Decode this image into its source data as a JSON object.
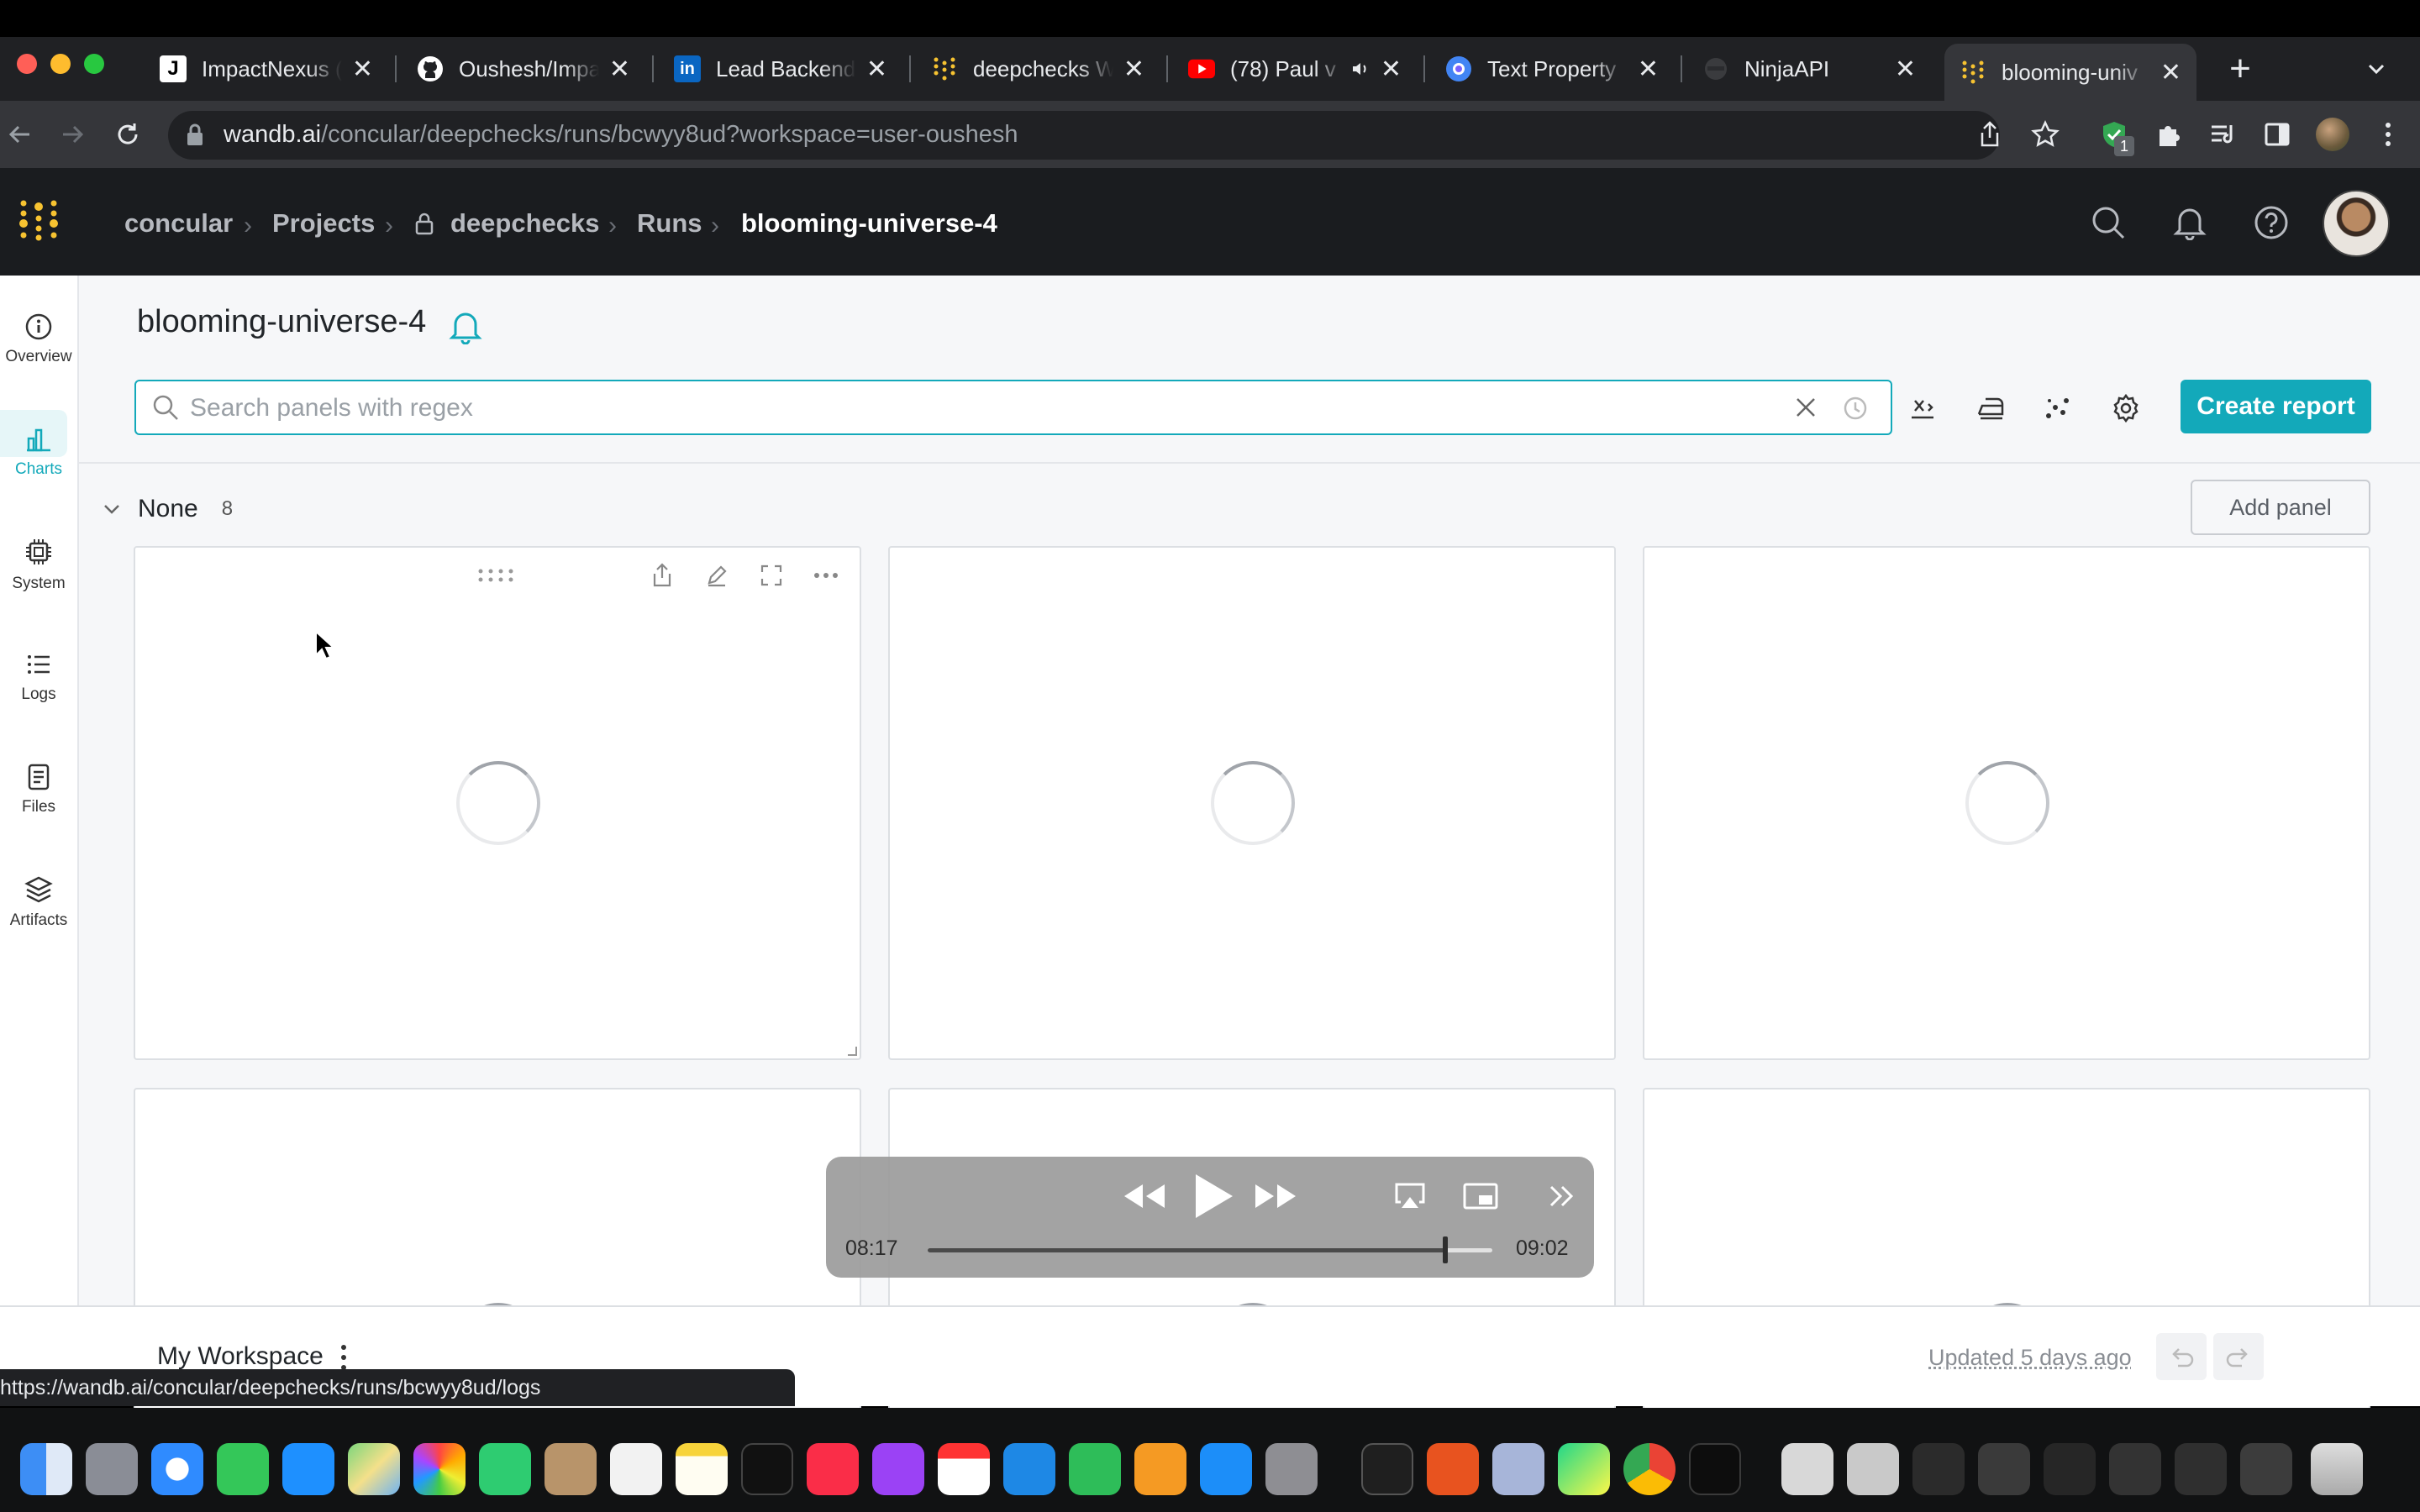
{
  "browser": {
    "tabs": [
      {
        "title": "ImpactNexus (",
        "icon": "jira-icon"
      },
      {
        "title": "Oushesh/Impa",
        "icon": "github-icon"
      },
      {
        "title": "Lead Backend",
        "icon": "linkedin-icon"
      },
      {
        "title": "deepchecks W",
        "icon": "wandb-icon"
      },
      {
        "title": "(78) Paul v",
        "icon": "youtube-icon"
      },
      {
        "title": "Text Property",
        "icon": "app-icon"
      },
      {
        "title": "NinjaAPI",
        "icon": "ninja-icon"
      },
      {
        "title": "blooming-univ",
        "icon": "wandb-icon"
      }
    ],
    "url_host": "wandb.ai",
    "url_path": "/concular/deepchecks/runs/bcwyy8ud?workspace=user-oushesh",
    "extension_badge": "1",
    "status_url": "https://wandb.ai/concular/deepchecks/runs/bcwyy8ud/logs"
  },
  "header": {
    "breadcrumbs": [
      "concular",
      "Projects",
      "deepchecks",
      "Runs",
      "blooming-universe-4"
    ]
  },
  "rail": {
    "items": [
      {
        "label": "Overview",
        "icon": "info-icon"
      },
      {
        "label": "Charts",
        "icon": "bar-chart-icon"
      },
      {
        "label": "System",
        "icon": "chip-icon"
      },
      {
        "label": "Logs",
        "icon": "list-icon"
      },
      {
        "label": "Files",
        "icon": "file-icon"
      },
      {
        "label": "Artifacts",
        "icon": "layers-icon"
      }
    ]
  },
  "main": {
    "run_title": "blooming-universe-4",
    "search_placeholder": "Search panels with regex",
    "create_report_label": "Create report",
    "section": {
      "name": "None",
      "count": "8"
    },
    "add_panel_label": "Add panel"
  },
  "player": {
    "elapsed": "08:17",
    "total": "09:02",
    "progress": 0.917
  },
  "workspace": {
    "name": "My Workspace",
    "updated": "Updated 5 days ago"
  },
  "colors": {
    "accent": "#13a9ba",
    "header_bg": "#1a1c1f"
  }
}
